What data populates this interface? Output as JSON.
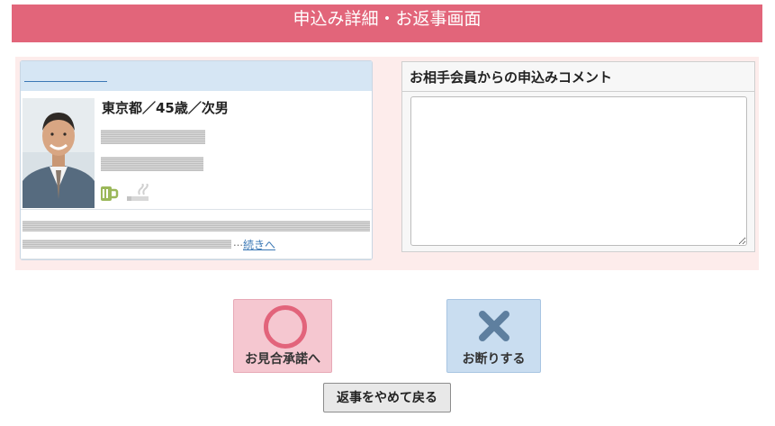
{
  "header": {
    "title": "申込み詳細・お返事画面"
  },
  "profile": {
    "basic_info": "東京都／45歳／次男",
    "more_link": "続きへ",
    "ellipsis": "…",
    "icons": [
      "beer-mug-icon",
      "cigarette-icon"
    ],
    "avatar_alt": "smiling man in suit"
  },
  "comment": {
    "title": "お相手会員からの申込みコメント",
    "value": ""
  },
  "actions": {
    "accept_label": "お見合承諾へ",
    "decline_label": "お断りする",
    "back_label": "返事をやめて戻る"
  },
  "colors": {
    "header": "#e2657a",
    "panel": "#fdeceb",
    "accept": "#f5c7d0",
    "decline": "#c9ddf0",
    "decline_icon": "#5e7f9f"
  }
}
